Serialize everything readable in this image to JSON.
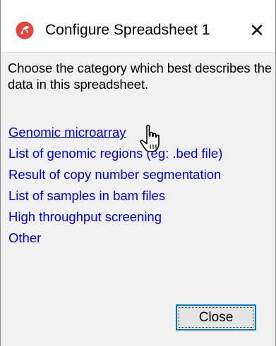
{
  "window": {
    "title": "Configure Spreadsheet 1",
    "close_glyph": "✕",
    "app_icon": "partek-logo-icon",
    "accent_color": "#e8443a"
  },
  "dialog": {
    "description": "Choose the category which best describes the data in this spreadsheet.",
    "options": [
      {
        "label": "Genomic microarray",
        "state": "hover"
      },
      {
        "label": "List of genomic regions (eg: .bed file)"
      },
      {
        "label": "Result of copy number segmentation"
      },
      {
        "label": "List of samples in bam files"
      },
      {
        "label": "High throughput screening"
      },
      {
        "label": "Other"
      }
    ],
    "link_color": "#0000ee",
    "close_button_label": "Close",
    "cursor": "hand-pointer-icon"
  }
}
